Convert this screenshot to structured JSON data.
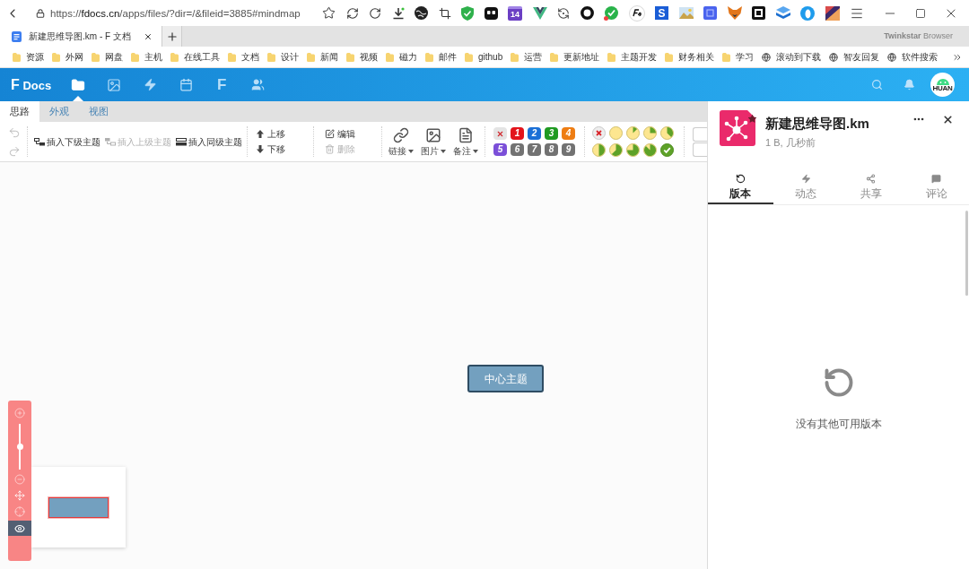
{
  "browser": {
    "url": {
      "scheme": "https://",
      "host": "fdocs.cn",
      "path": "/apps/files/?dir=/&fileid=3885#mindmap"
    },
    "calendar_badge": "14",
    "letter_tile": "S",
    "tab": {
      "title": "新建思维导图.km - F 文档"
    },
    "brand": "**Twinkstar** Browser",
    "bookmarks": [
      {
        "kind": "folder",
        "label": "资源"
      },
      {
        "kind": "folder",
        "label": "外网"
      },
      {
        "kind": "folder",
        "label": "网盘"
      },
      {
        "kind": "folder",
        "label": "主机"
      },
      {
        "kind": "folder",
        "label": "在线工具"
      },
      {
        "kind": "folder",
        "label": "文档"
      },
      {
        "kind": "folder",
        "label": "设计"
      },
      {
        "kind": "folder",
        "label": "新闻"
      },
      {
        "kind": "folder",
        "label": "视频"
      },
      {
        "kind": "folder",
        "label": "磁力"
      },
      {
        "kind": "folder",
        "label": "邮件"
      },
      {
        "kind": "folder",
        "label": "github"
      },
      {
        "kind": "folder",
        "label": "运营"
      },
      {
        "kind": "folder",
        "label": "更新地址"
      },
      {
        "kind": "folder",
        "label": "主题开发"
      },
      {
        "kind": "folder",
        "label": "财务相关"
      },
      {
        "kind": "folder",
        "label": "学习"
      },
      {
        "kind": "site",
        "label": "滚动到下载"
      },
      {
        "kind": "site",
        "label": "智友回复"
      },
      {
        "kind": "site",
        "label": "软件搜索"
      }
    ]
  },
  "app": {
    "logo": {
      "letter": "F",
      "name": "Docs"
    },
    "nav": [
      {
        "kind": "files",
        "selected": true
      },
      {
        "kind": "gallery",
        "selected": false
      },
      {
        "kind": "activity",
        "selected": false
      },
      {
        "kind": "calendar",
        "selected": false
      },
      {
        "kind": "letter",
        "label": "F",
        "selected": false
      },
      {
        "kind": "contacts",
        "selected": false
      }
    ],
    "avatar": {
      "label": "HUAN"
    }
  },
  "editor": {
    "tabs": [
      {
        "label": "思路",
        "selected": true
      },
      {
        "label": "外观",
        "selected": false
      },
      {
        "label": "视图",
        "selected": false
      }
    ],
    "toolbar": {
      "insert": [
        {
          "kind": "child",
          "label": "插入下级主题",
          "disabled": false
        },
        {
          "kind": "parent",
          "label": "插入上级主题",
          "disabled": true
        },
        {
          "kind": "sibling",
          "label": "插入同级主题",
          "disabled": false
        }
      ],
      "move": [
        {
          "kind": "up",
          "label": "上移"
        },
        {
          "kind": "down",
          "label": "下移"
        }
      ],
      "edit": [
        {
          "kind": "edit",
          "label": "编辑",
          "disabled": false
        },
        {
          "kind": "delete",
          "label": "删除",
          "disabled": true
        }
      ],
      "attach": [
        {
          "kind": "link",
          "label": "链接"
        },
        {
          "kind": "image",
          "label": "图片"
        },
        {
          "kind": "note",
          "label": "备注"
        }
      ],
      "priorities": [
        {
          "kind": "clear"
        },
        {
          "kind": "number",
          "label": "1",
          "color": "#e3141c"
        },
        {
          "kind": "number",
          "label": "2",
          "color": "#1b6fd6"
        },
        {
          "kind": "number",
          "label": "3",
          "color": "#1f9a22"
        },
        {
          "kind": "number",
          "label": "4",
          "color": "#ee7d13"
        },
        {
          "kind": "number",
          "label": "5",
          "color": "#7b4fd8"
        },
        {
          "kind": "number",
          "label": "6",
          "color": "#727272"
        },
        {
          "kind": "number",
          "label": "7",
          "color": "#727272"
        },
        {
          "kind": "number",
          "label": "8",
          "color": "#727272"
        },
        {
          "kind": "number",
          "label": "9",
          "color": "#727272"
        }
      ],
      "progress": [
        {
          "kind": "clear"
        },
        {
          "kind": "empty"
        },
        {
          "kind": "eighth"
        },
        {
          "kind": "quarter"
        },
        {
          "kind": "three-eighths"
        },
        {
          "kind": "half"
        },
        {
          "kind": "five-eighths"
        },
        {
          "kind": "three-quarters"
        },
        {
          "kind": "seven-eighths"
        },
        {
          "kind": "done"
        }
      ]
    },
    "canvas": {
      "root_topic": "中心主题"
    },
    "zoom": {
      "level": 0.5
    },
    "navigator": {
      "open": true
    }
  },
  "details": {
    "file_name": "新建思维导图.km",
    "starred": true,
    "meta": "1 B, 几秒前",
    "tabs": [
      {
        "kind": "versions",
        "label": "版本",
        "selected": true
      },
      {
        "kind": "activity",
        "label": "动态",
        "selected": false
      },
      {
        "kind": "sharing",
        "label": "共享",
        "selected": false
      },
      {
        "kind": "comments",
        "label": "评论",
        "selected": false
      }
    ],
    "empty_message": "没有其他可用版本"
  }
}
